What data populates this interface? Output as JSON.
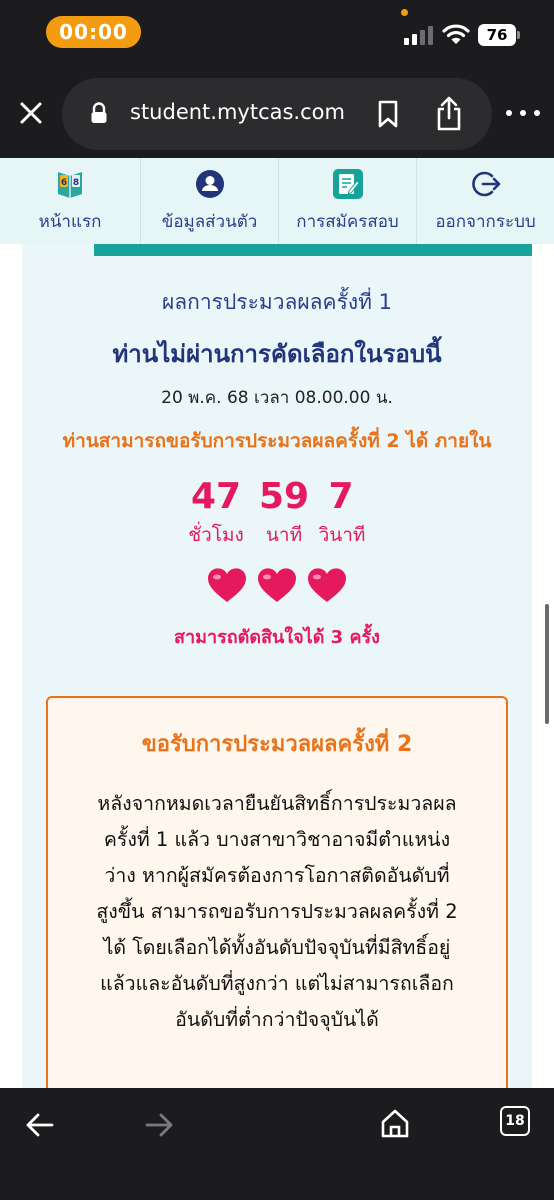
{
  "status_bar": {
    "time": "00:00",
    "battery": "76"
  },
  "browser": {
    "url": "student.mytcas.com"
  },
  "nav": {
    "items": [
      {
        "label": "หน้าแรก"
      },
      {
        "label": "ข้อมูลส่วนตัว"
      },
      {
        "label": "การสมัครสอบ"
      },
      {
        "label": "ออกจากระบบ"
      }
    ],
    "logo_text": "68"
  },
  "result": {
    "title": "ผลการประมวลผลครั้งที่ 1",
    "status": "ท่านไม่ผ่านการคัดเลือกในรอบนี้",
    "date": "20 พ.ค. 68 เวลา 08.00.00 น.",
    "notice": "ท่านสามารถขอรับการประมวลผลครั้งที่ 2 ได้ ภายใน"
  },
  "countdown": {
    "hours": "47",
    "hours_label": "ชั่วโมง",
    "minutes": "59",
    "minutes_label": "นาที",
    "seconds": "7",
    "seconds_label": "วินาที"
  },
  "decisions": {
    "hearts_remaining": 3,
    "label": "สามารถตัดสินใจได้ 3 ครั้ง"
  },
  "info_box": {
    "title": "ขอรับการประมวลผลครั้งที่ 2",
    "lines": [
      "หลังจากหมดเวลายืนยันสิทธิ์การประมวลผล",
      "ครั้งที่ 1 แล้ว บางสาขาวิชาอาจมีตำแหน่ง",
      "ว่าง หากผู้สมัครต้องการโอกาสติดอันดับที่",
      "สูงขึ้น สามารถขอรับการประมวลผลครั้งที่ 2",
      "ได้ โดยเลือกได้ทั้งอันดับปัจจุบันที่มีสิทธิ์อยู่",
      "แล้วและอันดับที่สูงกว่า แต่ไม่สามารถเลือก",
      "อันดับที่ต่ำกว่าปัจจุบันได้"
    ]
  },
  "toolbar": {
    "tab_count": "18"
  },
  "colors": {
    "accent_orange": "#e8731a",
    "accent_pink": "#e5195e",
    "navy": "#23357a",
    "teal": "#17a39a"
  }
}
